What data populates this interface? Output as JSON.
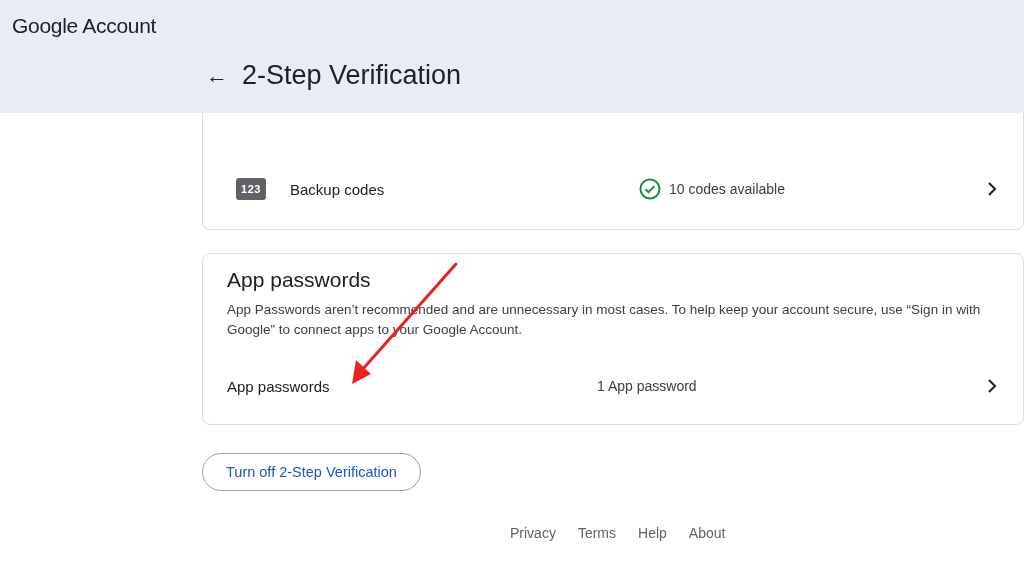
{
  "header": {
    "brand": "Google Account",
    "back": "←",
    "title": "2-Step Verification"
  },
  "methods_card": {
    "rows": [
      {
        "kind": "code",
        "icon_text": "123",
        "label": "Backup codes",
        "status": "10 codes available",
        "verified": true
      }
    ]
  },
  "app_passwords_card": {
    "title": "App passwords",
    "description": "App Passwords aren’t recommended and are unnecessary in most cases. To help keep your account secure, use “Sign in with Google” to connect apps to your Google Account.",
    "row": {
      "label": "App passwords",
      "value": "1 App password"
    }
  },
  "turn_off_button": "Turn off 2-Step Verification",
  "footer_links": [
    "Privacy",
    "Terms",
    "Help",
    "About"
  ]
}
